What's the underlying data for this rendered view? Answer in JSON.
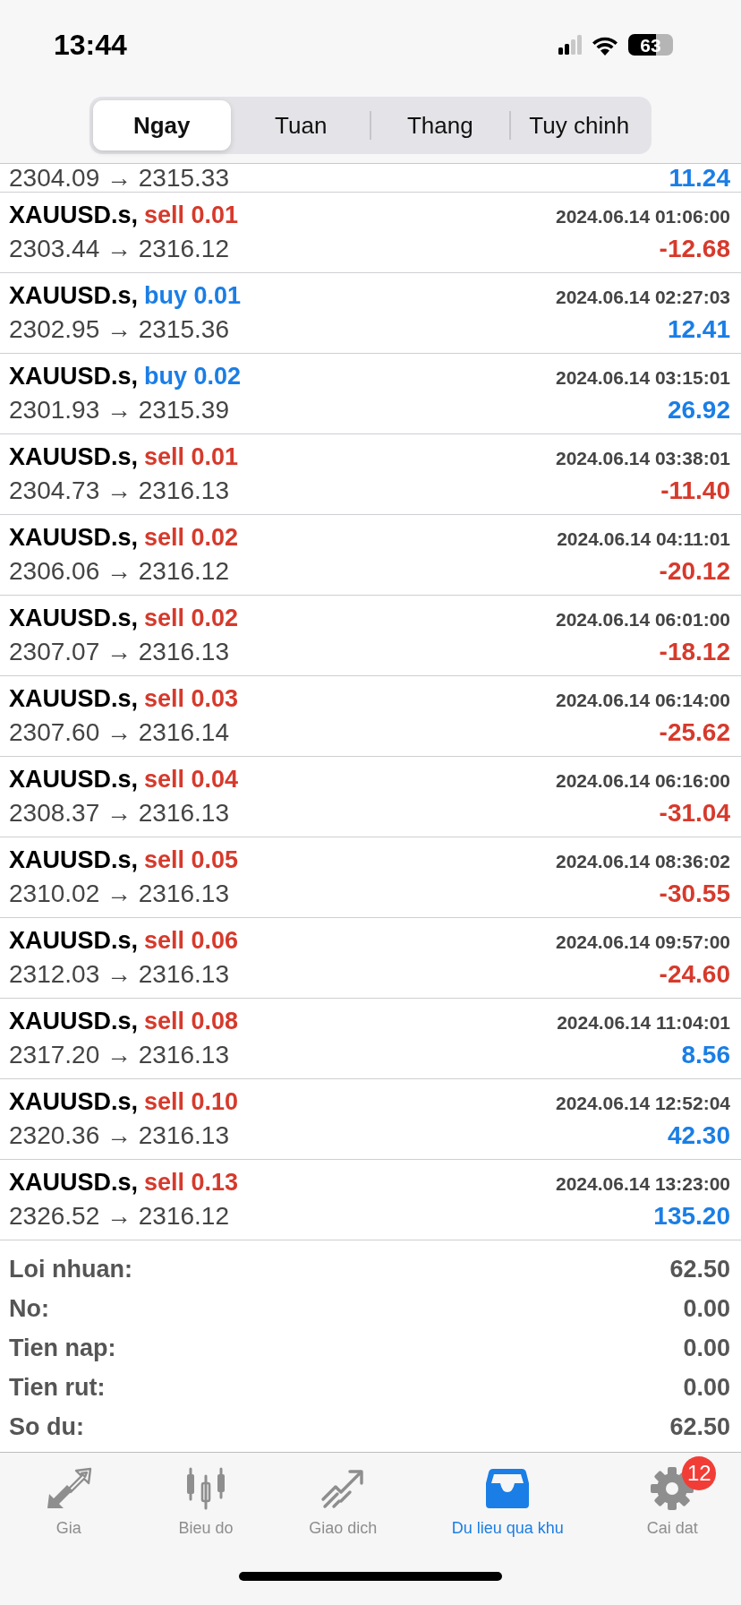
{
  "status_bar": {
    "time": "13:44",
    "battery": "63"
  },
  "segments": [
    {
      "label": "Ngay",
      "selected": true
    },
    {
      "label": "Tuan",
      "selected": false
    },
    {
      "label": "Thang",
      "selected": false
    },
    {
      "label": "Tuy chinh",
      "selected": false
    }
  ],
  "partial_row": {
    "prices": "2304.09 → 2315.33",
    "profit": "11.24",
    "loss": false
  },
  "deals": [
    {
      "symbol": "XAUUSD.s,",
      "trade": "sell 0.01",
      "sell": true,
      "time": "2024.06.14 01:06:00",
      "prices": "2303.44 → 2316.12",
      "profit": "-12.68",
      "loss": true
    },
    {
      "symbol": "XAUUSD.s,",
      "trade": "buy 0.01",
      "sell": false,
      "time": "2024.06.14 02:27:03",
      "prices": "2302.95 → 2315.36",
      "profit": "12.41",
      "loss": false
    },
    {
      "symbol": "XAUUSD.s,",
      "trade": "buy 0.02",
      "sell": false,
      "time": "2024.06.14 03:15:01",
      "prices": "2301.93 → 2315.39",
      "profit": "26.92",
      "loss": false
    },
    {
      "symbol": "XAUUSD.s,",
      "trade": "sell 0.01",
      "sell": true,
      "time": "2024.06.14 03:38:01",
      "prices": "2304.73 → 2316.13",
      "profit": "-11.40",
      "loss": true
    },
    {
      "symbol": "XAUUSD.s,",
      "trade": "sell 0.02",
      "sell": true,
      "time": "2024.06.14 04:11:01",
      "prices": "2306.06 → 2316.12",
      "profit": "-20.12",
      "loss": true
    },
    {
      "symbol": "XAUUSD.s,",
      "trade": "sell 0.02",
      "sell": true,
      "time": "2024.06.14 06:01:00",
      "prices": "2307.07 → 2316.13",
      "profit": "-18.12",
      "loss": true
    },
    {
      "symbol": "XAUUSD.s,",
      "trade": "sell 0.03",
      "sell": true,
      "time": "2024.06.14 06:14:00",
      "prices": "2307.60 → 2316.14",
      "profit": "-25.62",
      "loss": true
    },
    {
      "symbol": "XAUUSD.s,",
      "trade": "sell 0.04",
      "sell": true,
      "time": "2024.06.14 06:16:00",
      "prices": "2308.37 → 2316.13",
      "profit": "-31.04",
      "loss": true
    },
    {
      "symbol": "XAUUSD.s,",
      "trade": "sell 0.05",
      "sell": true,
      "time": "2024.06.14 08:36:02",
      "prices": "2310.02 → 2316.13",
      "profit": "-30.55",
      "loss": true
    },
    {
      "symbol": "XAUUSD.s,",
      "trade": "sell 0.06",
      "sell": true,
      "time": "2024.06.14 09:57:00",
      "prices": "2312.03 → 2316.13",
      "profit": "-24.60",
      "loss": true
    },
    {
      "symbol": "XAUUSD.s,",
      "trade": "sell 0.08",
      "sell": true,
      "time": "2024.06.14 11:04:01",
      "prices": "2317.20 → 2316.13",
      "profit": "8.56",
      "loss": false
    },
    {
      "symbol": "XAUUSD.s,",
      "trade": "sell 0.10",
      "sell": true,
      "time": "2024.06.14 12:52:04",
      "prices": "2320.36 → 2316.13",
      "profit": "42.30",
      "loss": false
    },
    {
      "symbol": "XAUUSD.s,",
      "trade": "sell 0.13",
      "sell": true,
      "time": "2024.06.14 13:23:00",
      "prices": "2326.52 → 2316.12",
      "profit": "135.20",
      "loss": false
    }
  ],
  "summary": [
    {
      "label": "Loi nhuan:",
      "value": "62.50"
    },
    {
      "label": "No:",
      "value": "0.00"
    },
    {
      "label": "Tien nap:",
      "value": "0.00"
    },
    {
      "label": "Tien rut:",
      "value": "0.00"
    },
    {
      "label": "So du:",
      "value": "62.50"
    }
  ],
  "tab_bar": [
    {
      "label": "Gia",
      "kind": "quotes",
      "selected": false
    },
    {
      "label": "Bieu do",
      "kind": "chart",
      "selected": false
    },
    {
      "label": "Giao dich",
      "kind": "trade",
      "selected": false
    },
    {
      "label": "Du lieu qua khu",
      "kind": "history",
      "selected": true
    },
    {
      "label": "Cai dat",
      "kind": "settings",
      "selected": false,
      "badge": "12"
    }
  ]
}
